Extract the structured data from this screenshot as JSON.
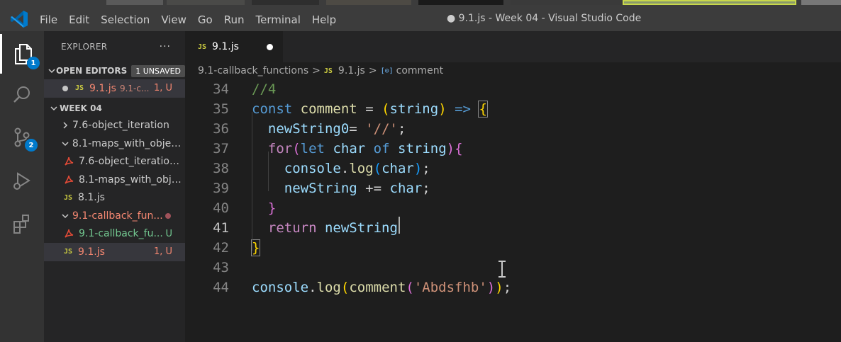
{
  "window": {
    "title": "● 9.1.js - Week 04 - Visual Studio Code",
    "menu": [
      "File",
      "Edit",
      "Selection",
      "View",
      "Go",
      "Run",
      "Terminal",
      "Help"
    ]
  },
  "activity_bar": {
    "items": [
      {
        "name": "explorer-icon",
        "badge": "1"
      },
      {
        "name": "search-icon",
        "badge": ""
      },
      {
        "name": "source-control-icon",
        "badge": "2"
      },
      {
        "name": "run-debug-icon",
        "badge": ""
      },
      {
        "name": "extensions-icon",
        "badge": ""
      }
    ]
  },
  "sidebar": {
    "title": "EXPLORER",
    "more": "···",
    "open_editors": {
      "label": "OPEN EDITORS",
      "badge": "1 UNSAVED",
      "items": [
        {
          "icon": "JS",
          "name": "9.1.js",
          "folder": "9.1-c...",
          "status": "1, U"
        }
      ]
    },
    "workspace": {
      "label": "WEEK 04",
      "items": [
        {
          "type": "folder",
          "expanded": false,
          "name": "7.6-object_iteration",
          "status": ""
        },
        {
          "type": "folder",
          "expanded": true,
          "name": "8.1-maps_with_objects",
          "status": ""
        },
        {
          "type": "pdf",
          "name": "7.6-object_iteration....",
          "status": ""
        },
        {
          "type": "pdf",
          "name": "8.1-maps_with_obje...",
          "status": ""
        },
        {
          "type": "js",
          "icon": "JS",
          "name": "8.1.js",
          "status": ""
        },
        {
          "type": "folder",
          "expanded": true,
          "name": "9.1-callback_fun...",
          "status": ""
        },
        {
          "type": "pdf",
          "name": "9.1-callback_fu...",
          "status": "U"
        },
        {
          "type": "js",
          "icon": "JS",
          "name": "9.1.js",
          "status": "1, U"
        }
      ]
    }
  },
  "editor": {
    "tab": {
      "icon": "JS",
      "label": "9.1.js"
    },
    "breadcrumb": {
      "folder": "9.1-callback_functions",
      "file_icon": "JS",
      "file": "9.1.js",
      "symbol_icon": "[⊙]",
      "symbol": "comment",
      "separator": ">"
    },
    "lines": [
      {
        "number": "34",
        "text": "//4"
      },
      {
        "number": "35",
        "text": "const comment = (string) => {"
      },
      {
        "number": "36",
        "text": "  newString0= '//';"
      },
      {
        "number": "37",
        "text": "  for(let char of string){"
      },
      {
        "number": "38",
        "text": "    console.log(char);"
      },
      {
        "number": "39",
        "text": "    newString += char;"
      },
      {
        "number": "40",
        "text": "  }"
      },
      {
        "number": "41",
        "text": "  return newString"
      },
      {
        "number": "42",
        "text": "}"
      },
      {
        "number": "43",
        "text": ""
      },
      {
        "number": "44",
        "text": "console.log(comment('Abdsfhb'));"
      }
    ],
    "current_line": "41"
  }
}
